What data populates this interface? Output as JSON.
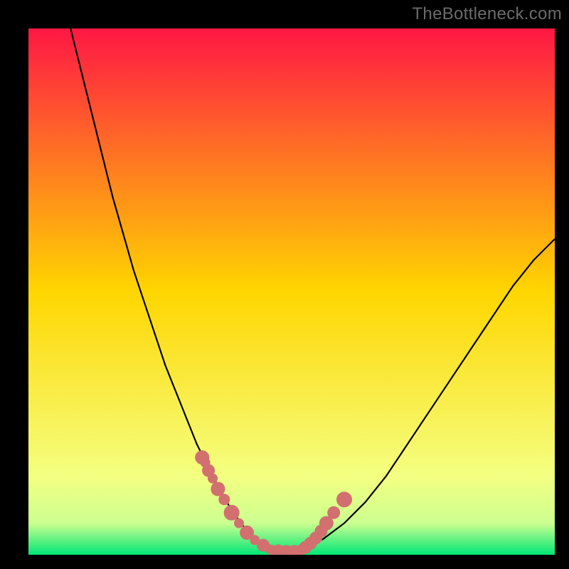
{
  "credit": "TheBottleneck.com",
  "colors": {
    "frame": "#000000",
    "curve": "#000000",
    "markers": "#d26f6f",
    "credit_text": "#6b6b6b",
    "gradient_stops": [
      {
        "offset": 0.0,
        "color": "#ff1744"
      },
      {
        "offset": 0.5,
        "color": "#ffd600"
      },
      {
        "offset": 0.85,
        "color": "#f4ff81"
      },
      {
        "offset": 0.94,
        "color": "#ccff90"
      },
      {
        "offset": 1.0,
        "color": "#00e676"
      }
    ]
  },
  "chart_data": {
    "type": "line",
    "title": "",
    "xlabel": "",
    "ylabel": "",
    "xlim": [
      0,
      100
    ],
    "ylim": [
      0,
      100
    ],
    "grid": false,
    "legend": false,
    "series": [
      {
        "name": "curve",
        "x": [
          8,
          10,
          12,
          14,
          16,
          18,
          20,
          22,
          24,
          26,
          28,
          30,
          32,
          34,
          36,
          38,
          40,
          42,
          44,
          46,
          48,
          50,
          52,
          56,
          60,
          64,
          68,
          72,
          76,
          80,
          84,
          88,
          92,
          96,
          100
        ],
        "y": [
          100,
          92,
          84,
          76,
          68,
          61,
          54,
          48,
          42,
          36,
          31,
          26,
          21,
          17,
          13,
          9.5,
          6.5,
          4,
          2.2,
          1,
          0.4,
          0.4,
          1,
          3,
          6,
          10,
          15,
          21,
          27,
          33,
          39,
          45,
          51,
          56,
          60
        ]
      }
    ],
    "markers": {
      "name": "highlighted-points",
      "x": [
        33,
        33.6,
        34.2,
        35.0,
        36.0,
        37.2,
        38.6,
        40.0,
        41.5,
        43.0,
        44.6,
        46.0,
        47.5,
        49.0,
        50.5,
        51.6,
        52.6,
        53.6,
        54.6,
        55.6,
        56.6,
        58.0,
        60.0
      ],
      "y": [
        18.5,
        17.5,
        16.0,
        14.5,
        12.5,
        10.5,
        8.0,
        6.0,
        4.2,
        2.8,
        1.8,
        1.0,
        0.6,
        0.5,
        0.5,
        0.8,
        1.4,
        2.2,
        3.2,
        4.5,
        6.0,
        8.0,
        10.5
      ],
      "r": [
        10,
        7,
        9,
        7,
        10,
        8,
        11,
        7,
        10,
        7,
        9,
        7,
        10,
        10,
        10,
        8,
        9,
        9,
        9,
        9,
        10,
        9,
        11
      ]
    }
  }
}
